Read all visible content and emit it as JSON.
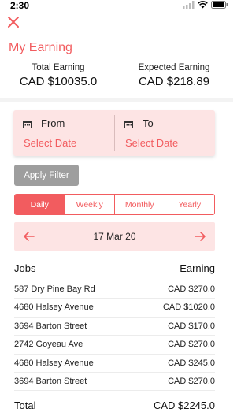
{
  "status": {
    "time": "2:30"
  },
  "header": {
    "title": "My Earning"
  },
  "summary": {
    "total_label": "Total Earning",
    "total_value": "CAD $10035.0",
    "expected_label": "Expected Earning",
    "expected_value": "CAD $218.89"
  },
  "date_filter": {
    "from_label": "From",
    "from_placeholder": "Select Date",
    "to_label": "To",
    "to_placeholder": "Select Date"
  },
  "apply_label": "Apply Filter",
  "tabs": [
    {
      "label": "Daily",
      "active": true
    },
    {
      "label": "Weekly",
      "active": false
    },
    {
      "label": "Monthly",
      "active": false
    },
    {
      "label": "Yearly",
      "active": false
    }
  ],
  "date_nav": {
    "current": "17 Mar 20"
  },
  "table": {
    "col_jobs": "Jobs",
    "col_earning": "Earning",
    "rows": [
      {
        "job": "587 Dry Pine Bay Rd",
        "amount": "CAD $270.0"
      },
      {
        "job": "4680 Halsey Avenue",
        "amount": "CAD $1020.0"
      },
      {
        "job": "3694 Barton Street",
        "amount": "CAD $170.0"
      },
      {
        "job": "2742 Goyeau Ave",
        "amount": "CAD $270.0"
      },
      {
        "job": "4680 Halsey Avenue",
        "amount": "CAD $245.0"
      },
      {
        "job": "3694 Barton Street",
        "amount": "CAD $270.0"
      }
    ],
    "total_label": "Total",
    "total_value": "CAD $2245.0"
  },
  "colors": {
    "accent": "#f25c5f",
    "tint": "#fde4e4",
    "button_gray": "#9e9e9e"
  }
}
